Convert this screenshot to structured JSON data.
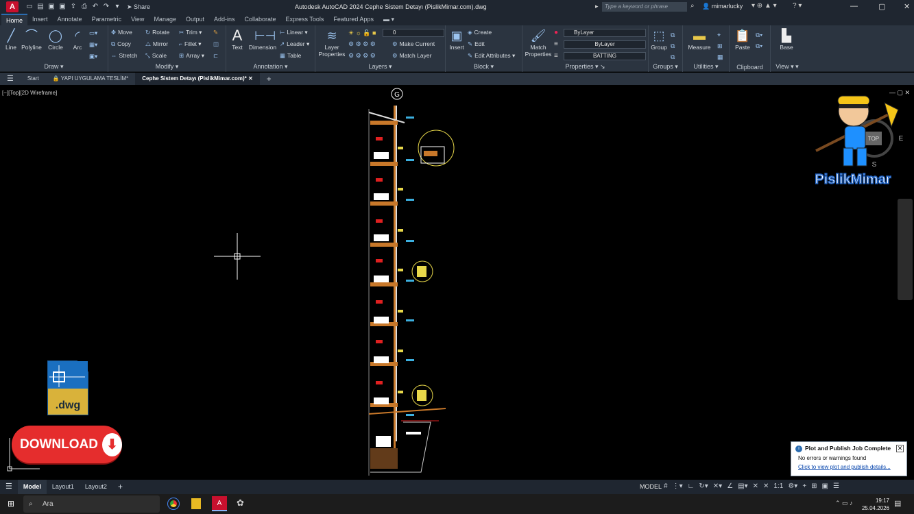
{
  "titlebar": {
    "app_letter": "A",
    "share": "Share",
    "title": "Autodesk AutoCAD 2024   Cephe Sistem Detayı (PislikMimar.com).dwg",
    "search_placeholder": "Type a keyword or phrase",
    "user": "mimarlucky"
  },
  "ribbon_tabs": [
    "Home",
    "Insert",
    "Annotate",
    "Parametric",
    "View",
    "Manage",
    "Output",
    "Add-ins",
    "Collaborate",
    "Express Tools",
    "Featured Apps"
  ],
  "draw": {
    "label": "Draw",
    "line": "Line",
    "polyline": "Polyline",
    "circle": "Circle",
    "arc": "Arc"
  },
  "modify": {
    "label": "Modify",
    "move": "Move",
    "rotate": "Rotate",
    "trim": "Trim",
    "copy": "Copy",
    "mirror": "Mirror",
    "fillet": "Fillet",
    "stretch": "Stretch",
    "scale": "Scale",
    "array": "Array"
  },
  "annotation": {
    "label": "Annotation",
    "text": "Text",
    "dimension": "Dimension",
    "linear": "Linear",
    "leader": "Leader",
    "table": "Table"
  },
  "layers": {
    "label": "Layers",
    "layer_properties": "Layer Properties",
    "layer_value": "0",
    "make_current": "Make Current",
    "match_layer": "Match Layer"
  },
  "block": {
    "label": "Block",
    "insert": "Insert",
    "create": "Create",
    "edit": "Edit",
    "edit_attributes": "Edit Attributes"
  },
  "properties": {
    "label": "Properties",
    "match_properties": "Match Properties",
    "color": "ByLayer",
    "linetype": "ByLayer",
    "lineweight": "BATTING"
  },
  "groups": {
    "label": "Groups",
    "group": "Group"
  },
  "utilities": {
    "label": "Utilities",
    "measure": "Measure"
  },
  "clipboard": {
    "label": "Clipboard",
    "paste": "Paste"
  },
  "view": {
    "label": "View",
    "base": "Base"
  },
  "doc_tabs": {
    "start": "Start",
    "tab1": "YAPI UYGULAMA TESLİM*",
    "tab2": "Cephe Sistem Detayı (PislikMimar.com)*"
  },
  "viewport": {
    "label": "[−][Top][2D Wireframe]",
    "section_marker": "G",
    "viewcube_top": "TOP",
    "viewcube_e": "E",
    "viewcube_s": "S"
  },
  "overlay": {
    "dwg_ext": ".dwg",
    "download": "DOWNLOAD",
    "brand": "PislikMimar"
  },
  "notification": {
    "title": "Plot and Publish Job Complete",
    "body": "No errors or warnings found",
    "link": "Click to view plot and publish details..."
  },
  "status": {
    "model_tab": "Model",
    "layout1": "Layout1",
    "layout2": "Layout2",
    "model_label": "MODEL",
    "scale": "1:1"
  },
  "taskbar": {
    "search": "Ara",
    "time": "19:17",
    "date": "25.04.2026"
  },
  "colors": {
    "accent": "#2b6cb0",
    "download": "#e52d2d",
    "drawing_orange": "#c8782a",
    "drawing_yellow": "#e8d84a"
  }
}
